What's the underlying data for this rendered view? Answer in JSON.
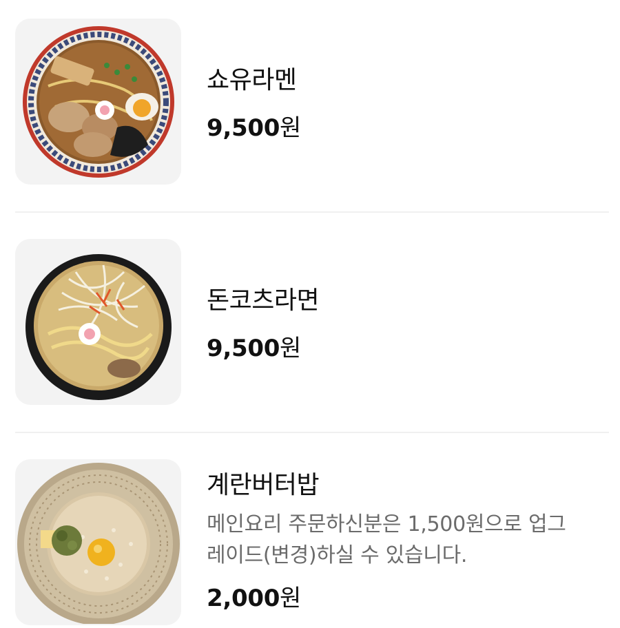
{
  "menu": {
    "items": [
      {
        "name": "쇼유라멘",
        "description": "",
        "price_amount": "9,500",
        "price_unit": "원",
        "image_icon": "shoyu-ramen-photo"
      },
      {
        "name": "돈코츠라면",
        "description": "",
        "price_amount": "9,500",
        "price_unit": "원",
        "image_icon": "tonkotsu-ramen-photo"
      },
      {
        "name": "계란버터밥",
        "description_line1": "메인요리 주문하신분은 1,500원으로 업그",
        "description_line2": "레이드(변경)하실 수 있습니다.",
        "price_amount": "2,000",
        "price_unit": "원",
        "image_icon": "egg-butter-rice-photo"
      }
    ]
  }
}
